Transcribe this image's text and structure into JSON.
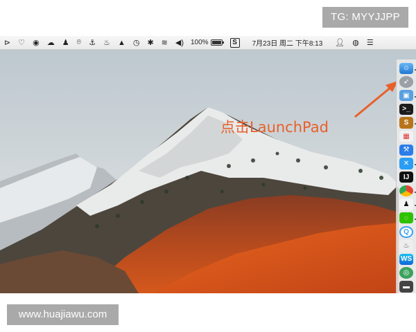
{
  "watermarks": {
    "tg": "TG: MYYJJPP",
    "site": "www.huajiawu.com"
  },
  "menubar": {
    "battery_percent": "100%",
    "battery_level": 1.0,
    "datetime": "7月23日 周二 下午8:13",
    "icons": [
      "playback-icon",
      "heart-icon",
      "globe-icon",
      "cloud-icon",
      "qq-icon",
      "chat-icon",
      "anchor-icon",
      "teapot-icon",
      "hat-icon",
      "time-machine-icon",
      "bluetooth-icon",
      "wifi-icon",
      "volume-icon",
      "s-app-icon",
      "user-icon",
      "siri-icon",
      "notification-center-icon"
    ]
  },
  "annotation": {
    "text": "点击LaunchPad"
  },
  "dock": {
    "items": [
      "finder-icon",
      "launchpad-icon",
      "preview-icon",
      "terminal-icon",
      "sublime-icon",
      "launchpad-grid-icon",
      "xcode-icon",
      "vscode-icon",
      "intellij-icon",
      "chrome-icon",
      "qq-dock-icon",
      "wechat-icon",
      "qq-browser-icon",
      "teapot-dock-icon",
      "webstorm-icon",
      "tool-icon",
      "last-dock-icon"
    ]
  },
  "colors": {
    "annotation": "#e8602a",
    "arrow": "#e8602a",
    "badge_bg": "#a9a9a9"
  }
}
